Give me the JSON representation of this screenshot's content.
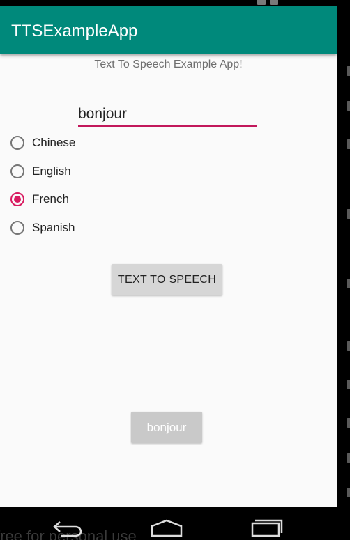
{
  "app": {
    "title": "TTSExampleApp",
    "subtitle": "Text To Speech Example App!"
  },
  "input": {
    "value": "bonjour"
  },
  "languages": [
    {
      "label": "Chinese",
      "checked": false
    },
    {
      "label": "English",
      "checked": false
    },
    {
      "label": "French",
      "checked": true
    },
    {
      "label": "Spanish",
      "checked": false
    }
  ],
  "buttons": {
    "tts_label": "TEXT TO SPEECH",
    "result_label": "bonjour"
  },
  "watermark": "free for personal use",
  "colors": {
    "app_bar": "#00897b",
    "accent": "#d81b60",
    "button_bg": "#d6d6d6"
  },
  "icons": {
    "nav": [
      "back-icon",
      "home-icon",
      "recents-icon"
    ]
  }
}
